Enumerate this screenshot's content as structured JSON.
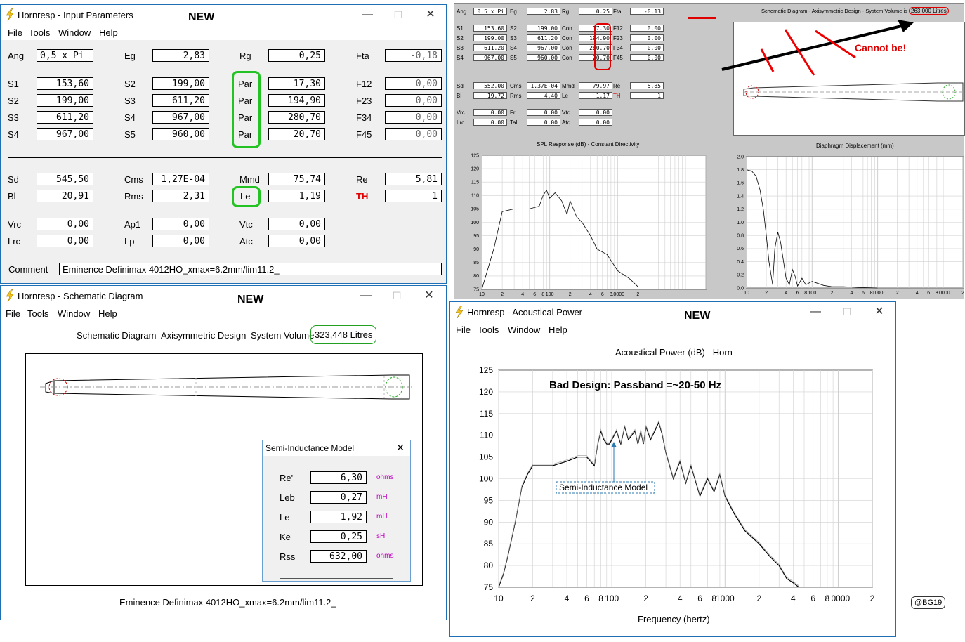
{
  "colors": {
    "accent_green": "#22c322",
    "annot_red": "#e00000",
    "window_border": "#1f6fb5",
    "unit_magenta": "#c000c0"
  },
  "menu": [
    "File",
    "Tools",
    "Window",
    "Help"
  ],
  "input_window": {
    "title": "Hornresp - Input Parameters",
    "new_label": "NEW",
    "row1": {
      "ang_label": "Ang",
      "ang": "0,5 x Pi",
      "eg_label": "Eg",
      "eg": "2,83",
      "rg_label": "Rg",
      "rg": "0,25",
      "fta_label": "Fta",
      "fta": "-0,18"
    },
    "rows": [
      {
        "a": "S1",
        "av": "153,60",
        "b": "S2",
        "bv": "199,00",
        "p": "Par",
        "pv": "17,30",
        "f": "F12",
        "fv": "0,00"
      },
      {
        "a": "S2",
        "av": "199,00",
        "b": "S3",
        "bv": "611,20",
        "p": "Par",
        "pv": "194,90",
        "f": "F23",
        "fv": "0,00"
      },
      {
        "a": "S3",
        "av": "611,20",
        "b": "S4",
        "bv": "967,00",
        "p": "Par",
        "pv": "280,70",
        "f": "F34",
        "fv": "0,00"
      },
      {
        "a": "S4",
        "av": "967,00",
        "b": "S5",
        "bv": "960,00",
        "p": "Par",
        "pv": "20,70",
        "f": "F45",
        "fv": "0,00"
      }
    ],
    "driver": {
      "sd_label": "Sd",
      "sd": "545,50",
      "cms_label": "Cms",
      "cms": "1,27E-04",
      "mmd_label": "Mmd",
      "mmd": "75,74",
      "re_label": "Re",
      "re": "5,81",
      "bl_label": "Bl",
      "bl": "20,91",
      "rms_label": "Rms",
      "rms": "2,31",
      "le_label": "Le",
      "le": "1,19",
      "th_label": "TH",
      "th": "1"
    },
    "chamber": {
      "vrc_label": "Vrc",
      "vrc": "0,00",
      "ap1_label": "Ap1",
      "ap1": "0,00",
      "vtc_label": "Vtc",
      "vtc": "0,00",
      "lrc_label": "Lrc",
      "lrc": "0,00",
      "lp_label": "Lp",
      "lp": "0,00",
      "atc_label": "Atc",
      "atc": "0,00"
    },
    "comment_label": "Comment",
    "comment": "Eminence Definimax 4012HO_xmax=6.2mm/lim11.2_"
  },
  "schematic_window": {
    "title": "Hornresp - Schematic Diagram",
    "new_label": "NEW",
    "heading": "Schematic Diagram",
    "design": "Axisymmetric Design",
    "volume_label": "System Volume",
    "volume": "323,448 Litres",
    "footer": "Eminence Definimax 4012HO_xmax=6.2mm/lim11.2_"
  },
  "semi_dialog": {
    "title": "Semi-Inductance Model",
    "rows": [
      {
        "label": "Re'",
        "value": "6,30",
        "unit": "ohms"
      },
      {
        "label": "Leb",
        "value": "0,27",
        "unit": "mH"
      },
      {
        "label": "Le",
        "value": "1,92",
        "unit": "mH"
      },
      {
        "label": "Ke",
        "value": "0,25",
        "unit": "sH"
      },
      {
        "label": "Rss",
        "value": "632,00",
        "unit": "ohms"
      }
    ]
  },
  "reference_panel": {
    "row1": [
      {
        "l": "Ang",
        "v": "0.5 x Pi"
      },
      {
        "l": "Eg",
        "v": "2.83"
      },
      {
        "l": "Rg",
        "v": "0.25"
      },
      {
        "l": "Fta",
        "v": "-0.13"
      }
    ],
    "rows": [
      {
        "a": "S1",
        "av": "153.60",
        "b": "S2",
        "bv": "199.00",
        "c": "Con",
        "cv": "17.30",
        "f": "F12",
        "fv": "0.00"
      },
      {
        "a": "S2",
        "av": "199.00",
        "b": "S3",
        "bv": "611.20",
        "c": "Con",
        "cv": "194.90",
        "f": "F23",
        "fv": "0.00"
      },
      {
        "a": "S3",
        "av": "611.20",
        "b": "S4",
        "bv": "967.00",
        "c": "Con",
        "cv": "280.70",
        "f": "F34",
        "fv": "0.00"
      },
      {
        "a": "S4",
        "av": "967.00",
        "b": "S5",
        "bv": "960.00",
        "c": "Con",
        "cv": "20.70",
        "f": "F45",
        "fv": "0.00"
      }
    ],
    "drv1": [
      {
        "l": "Sd",
        "v": "552.00"
      },
      {
        "l": "Cms",
        "v": "1.37E-04"
      },
      {
        "l": "Mmd",
        "v": "79.97"
      },
      {
        "l": "Re",
        "v": "5.85"
      }
    ],
    "drv2": [
      {
        "l": "Bl",
        "v": "19.72"
      },
      {
        "l": "Rms",
        "v": "4.40"
      },
      {
        "l": "Le",
        "v": "1.17"
      },
      {
        "l": "TH",
        "v": "1"
      }
    ],
    "ch1": [
      {
        "l": "Vrc",
        "v": "0.00"
      },
      {
        "l": "Fr",
        "v": "0.00"
      },
      {
        "l": "Vtc",
        "v": "0.00"
      }
    ],
    "ch2": [
      {
        "l": "Lrc",
        "v": "0.00"
      },
      {
        "l": "Tal",
        "v": "0.00"
      },
      {
        "l": "Atc",
        "v": "0.00"
      }
    ],
    "schematic_title": "Schematic Diagram - Axisymmetric Design - System Volume is",
    "schematic_volume": "263.000 Litres",
    "annotation": "Cannot be!",
    "spl_title": "SPL Response (dB) - Constant Directivity",
    "disp_title": "Diaphragm Displacement (mm)"
  },
  "acoustic_window": {
    "title": "Hornresp - Acoustical Power",
    "new_label": "NEW",
    "chart_title": "Acoustical Power (dB)   Horn",
    "annotation": "Bad Design: Passband =~20-50 Hz",
    "callout": "Semi-Inductance Model",
    "xlabel": "Frequency (hertz)"
  },
  "credit": "@BG19",
  "chart_data": [
    {
      "type": "line",
      "title": "Acoustical Power (dB)   Horn",
      "xlabel": "Frequency (hertz)",
      "ylabel": "",
      "x_scale": "log",
      "xlim": [
        10,
        20000
      ],
      "ylim": [
        75,
        125
      ],
      "y_ticks": [
        75,
        80,
        85,
        90,
        95,
        100,
        105,
        110,
        115,
        120,
        125
      ],
      "x_tick_labels": [
        "10",
        "2",
        "4",
        "6",
        "8",
        "100",
        "2",
        "4",
        "6",
        "8",
        "1000",
        "2",
        "4",
        "6",
        "8",
        "10000",
        "2"
      ],
      "series": [
        {
          "x": [
            10,
            11,
            12,
            14,
            16,
            18,
            20,
            25,
            30,
            40,
            50,
            60,
            70,
            75,
            80,
            85,
            90,
            95,
            100,
            110,
            120,
            130,
            140,
            150,
            160,
            170,
            180,
            190,
            200,
            220,
            240,
            260,
            280,
            300,
            350,
            400,
            450,
            500,
            600,
            700,
            800,
            900,
            1000,
            1200,
            1500,
            2000,
            2500,
            3000,
            3500,
            4000,
            4500
          ],
          "y": [
            75,
            78,
            82,
            90,
            98,
            101,
            103,
            103,
            103,
            104,
            105,
            105,
            103,
            108,
            111,
            109,
            108,
            108,
            109,
            111,
            108,
            112,
            109,
            110,
            111,
            108,
            111,
            108,
            112,
            109,
            111,
            113,
            110,
            106,
            100,
            104,
            99,
            103,
            96,
            100,
            97,
            101,
            96,
            92,
            88,
            85,
            82,
            80,
            77,
            76,
            75
          ]
        }
      ]
    },
    {
      "type": "line",
      "title": "SPL Response (dB) - Constant Directivity",
      "x_scale": "log",
      "xlim": [
        10,
        20000
      ],
      "ylim": [
        75,
        125
      ],
      "y_ticks": [
        75,
        80,
        85,
        90,
        95,
        100,
        105,
        110,
        115,
        120,
        125
      ],
      "x_tick_labels": [
        "10",
        "2",
        "4",
        "6",
        "8",
        "100",
        "2",
        "4",
        "6",
        "8",
        "10000",
        "2"
      ],
      "series": [
        {
          "x": [
            10,
            15,
            20,
            30,
            50,
            70,
            80,
            90,
            100,
            120,
            150,
            180,
            200,
            250,
            300,
            400,
            500,
            700,
            1000,
            1500,
            2000
          ],
          "y": [
            75,
            90,
            104,
            105,
            105,
            106,
            110,
            112,
            109,
            111,
            108,
            103,
            108,
            102,
            100,
            95,
            90,
            88,
            82,
            79,
            76
          ]
        }
      ]
    },
    {
      "type": "line",
      "title": "Diaphragm Displacement (mm)",
      "x_scale": "log",
      "xlim": [
        10,
        20000
      ],
      "ylim": [
        0,
        2.0
      ],
      "y_ticks": [
        0.0,
        0.2,
        0.4,
        0.6,
        0.8,
        1.0,
        1.2,
        1.4,
        1.6,
        1.8,
        2.0
      ],
      "x_tick_labels": [
        "10",
        "2",
        "4",
        "6",
        "8",
        "100",
        "2",
        "4",
        "6",
        "8",
        "1000",
        "2",
        "4",
        "6",
        "8",
        "10000",
        "2"
      ],
      "series": [
        {
          "x": [
            10,
            12,
            14,
            16,
            18,
            20,
            22,
            25,
            27,
            30,
            33,
            40,
            45,
            50,
            55,
            60,
            70,
            80,
            100,
            150,
            200,
            300,
            500,
            1000
          ],
          "y": [
            1.8,
            1.78,
            1.7,
            1.5,
            1.2,
            0.8,
            0.4,
            0.05,
            0.6,
            0.85,
            0.7,
            0.15,
            0.05,
            0.28,
            0.18,
            0.03,
            0.15,
            0.05,
            0.1,
            0.04,
            0.02,
            0.02,
            0.01,
            0.0
          ]
        }
      ]
    }
  ]
}
